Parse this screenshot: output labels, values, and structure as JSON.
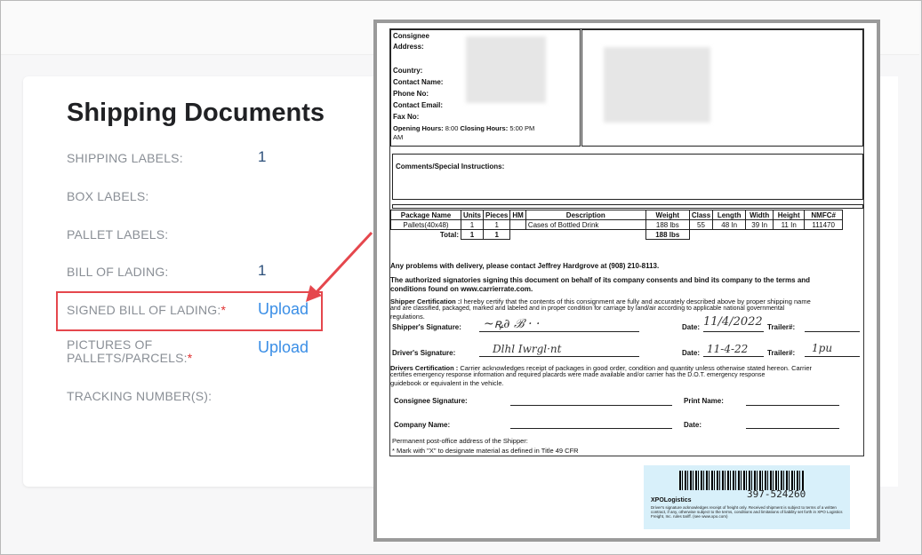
{
  "card": {
    "title": "Shipping Documents",
    "rows": [
      {
        "label": "SHIPPING LABELS:",
        "value": "1"
      },
      {
        "label": "BOX LABELS:",
        "value": ""
      },
      {
        "label": "PALLET LABELS:",
        "value": ""
      },
      {
        "label": "BILL OF LADING:",
        "value": "1"
      },
      {
        "label": "SIGNED BILL OF LADING:",
        "required": "*",
        "value": "Upload"
      },
      {
        "label": "PICTURES OF",
        "label2": "PALLETS/PARCELS:",
        "required": "*",
        "value": "Upload"
      },
      {
        "label": "TRACKING NUMBER(S):",
        "value": ""
      }
    ]
  },
  "doc": {
    "consignee": "Consignee",
    "address": "Address:",
    "country": "Country:",
    "contact_name": "Contact Name:",
    "phone": "Phone No:",
    "email": "Contact Email:",
    "fax": "Fax No:",
    "hours_label1": "Opening Hours:",
    "hours_value1": "8:00",
    "hours_label2": "Closing Hours:",
    "hours_value2": "5:00 PM",
    "hours_am": "AM",
    "comments": "Comments/Special Instructions:",
    "table": {
      "headers": [
        "Package Name",
        "Units",
        "Pieces",
        "HM",
        "Description",
        "Weight",
        "Class",
        "Length",
        "Width",
        "Height",
        "NMFC#"
      ],
      "row": [
        "Pallets(40x48)",
        "1",
        "1",
        "",
        "Cases of Bottled Drink",
        "188 lbs",
        "55",
        "48 In",
        "39 In",
        "11 In",
        "111470"
      ],
      "total_label": "Total:",
      "total_units": "1",
      "total_pieces": "1",
      "total_weight": "188 lbs"
    },
    "problems": "Any problems with delivery, please contact Jeffrey Hardgrove at (908) 210-8113.",
    "auth_line1": "The authorized signatories signing this document on behalf of its company consents and bind its company to the terms and",
    "auth_line2": "conditions found on www.carrierrate.com.",
    "shipper_cert_label": "Shipper Certification :",
    "shipper_cert_text1": "I hereby certify that the contents of this consignment are fully and accurately described above by proper shipping name",
    "shipper_cert_text2": "and are classified, packaged, marked and labeled and in proper condition for carriage by land/air according to applicable national governmental",
    "shipper_cert_text3": "regulations.",
    "shipper_sig": "Shipper's Signature:",
    "date": "Date:",
    "trailer": "Trailer#:",
    "shipper_date_hand": "11/4/2022",
    "driver_sig": "Driver's Signature:",
    "driver_date_hand": "11-4-22",
    "driver_trailer_hand": "1pu",
    "drivers_cert_label": "Drivers Certification :",
    "drivers_cert_text1": "Carrier acknowledges receipt of packages in good order, condition and quantity unless otherwise stated hereon. Carrier",
    "drivers_cert_text2": "certifies emergency response information and required placards were made available and/or carrier has the D.O.T. emergency response",
    "drivers_cert_text3": "guidebook or equivalent in the vehicle.",
    "consignee_sig": "Consignee Signature:",
    "print_name": "Print Name:",
    "company_name": "Company Name:",
    "date2": "Date:",
    "permanent": "Permanent post-office address of the Shipper:",
    "mark_note": "* Mark with \"X\" to designate material as defined in Title 49 CFR",
    "barcode_number": "397-524260",
    "xpo": "XPOLogistics",
    "xpo_fine": "Driver's signature acknowledges receipt of freight only. Received shipment is subject to terms of a written contract, if any, otherwise subject to the terms, conditions and limitations of liability set forth in XPO Logistics Freight, Inc. rules tariff. (see www.xpo.com)"
  }
}
